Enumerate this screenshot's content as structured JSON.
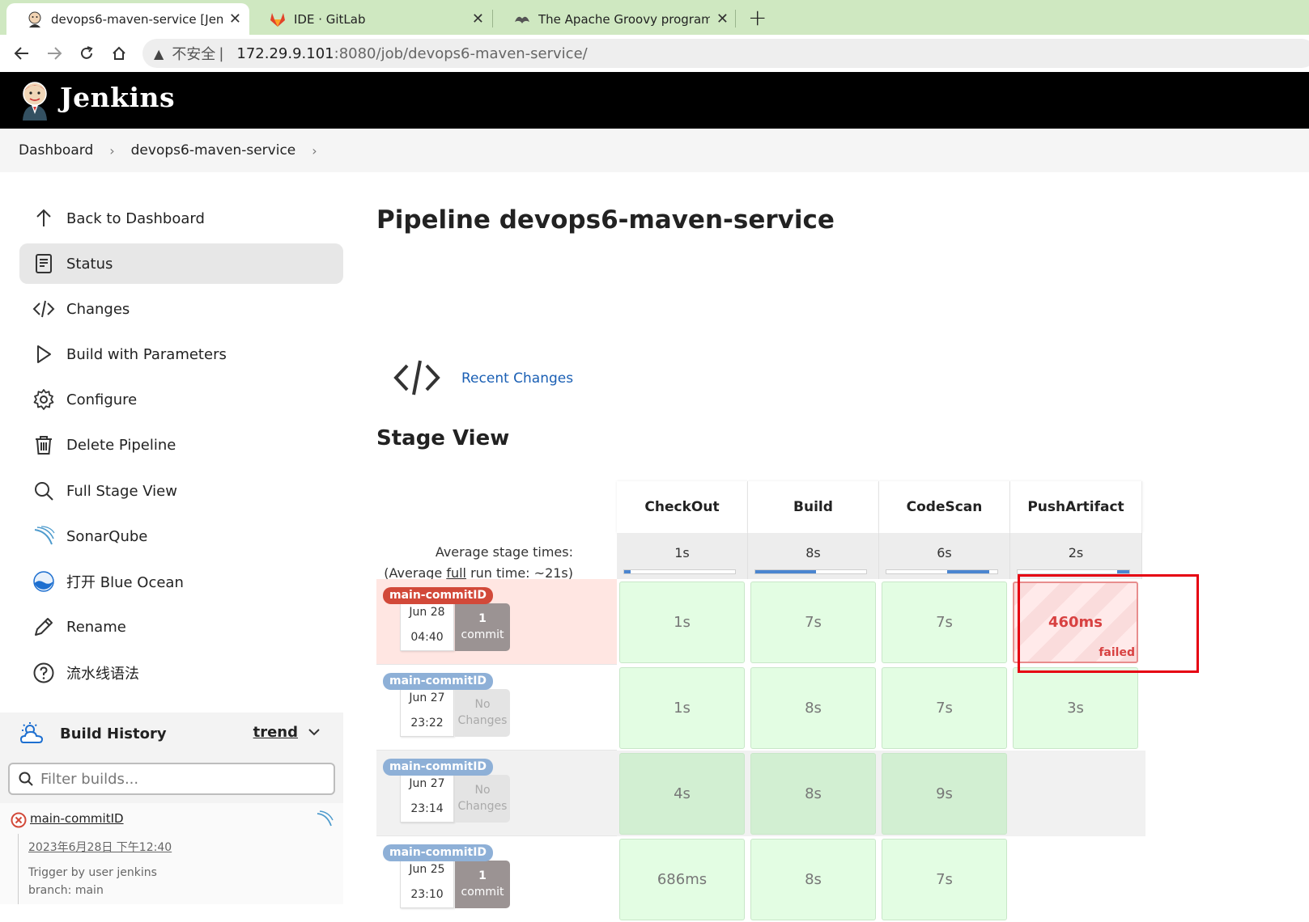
{
  "browser": {
    "tabs": [
      {
        "title": "devops6-maven-service [Jenkins]",
        "active": true
      },
      {
        "title": "IDE · GitLab",
        "active": false
      },
      {
        "title": "The Apache Groovy programming language",
        "active": false
      }
    ],
    "url": {
      "insecure_label": "不安全",
      "separator": "|",
      "host": "172.29.9.101",
      "path": ":8080/job/devops6-maven-service/"
    }
  },
  "header": {
    "brand": "Jenkins"
  },
  "breadcrumbs": [
    "Dashboard",
    "devops6-maven-service"
  ],
  "sidebar": {
    "items": [
      {
        "label": "Back to Dashboard",
        "icon": "arrow-up-icon"
      },
      {
        "label": "Status",
        "icon": "document-icon"
      },
      {
        "label": "Changes",
        "icon": "code-icon"
      },
      {
        "label": "Build with Parameters",
        "icon": "play-icon"
      },
      {
        "label": "Configure",
        "icon": "gear-icon"
      },
      {
        "label": "Delete Pipeline",
        "icon": "trash-icon"
      },
      {
        "label": "Full Stage View",
        "icon": "search-icon"
      },
      {
        "label": "SonarQube",
        "icon": "sonarqube-icon"
      },
      {
        "label": "打开 Blue Ocean",
        "icon": "blue-ocean-icon"
      },
      {
        "label": "Rename",
        "icon": "pencil-icon"
      },
      {
        "label": "流水线语法",
        "icon": "help-icon"
      }
    ]
  },
  "build_history": {
    "title": "Build History",
    "trend_label": "trend",
    "filter_placeholder": "Filter builds...",
    "latest": {
      "name": "main-commitID",
      "date": "2023年6月28日 下午12:40",
      "trigger": "Trigger by user jenkins",
      "branch": "branch: main"
    }
  },
  "main": {
    "title": "Pipeline devops6-maven-service",
    "recent_changes": "Recent Changes",
    "stage_view_title": "Stage View"
  },
  "stage_view": {
    "stages": [
      "CheckOut",
      "Build",
      "CodeScan",
      "PushArtifact"
    ],
    "avg_label": "Average stage times:",
    "avg_run_prefix": "(Average ",
    "avg_run_full": "full",
    "avg_run_suffix": " run time: ~21s)",
    "avg_times": [
      "1s",
      "8s",
      "6s",
      "2s"
    ],
    "avg_bars": [
      {
        "start": 0.0,
        "fill": 0.06
      },
      {
        "start": 0.0,
        "fill": 0.55
      },
      {
        "start": 0.55,
        "fill": 0.38
      },
      {
        "start": 0.89,
        "fill": 0.11
      }
    ],
    "runs": [
      {
        "badge": "main-commitID",
        "status": "failed",
        "date": "Jun 28",
        "time": "04:40",
        "changes_count": "1",
        "changes_label": "commit",
        "has_commit": true,
        "cells": [
          {
            "time": "1s",
            "state": "ok"
          },
          {
            "time": "7s",
            "state": "ok"
          },
          {
            "time": "7s",
            "state": "ok"
          },
          {
            "time": "460ms",
            "state": "fail",
            "label": "failed"
          }
        ]
      },
      {
        "badge": "main-commitID",
        "status": "success",
        "date": "Jun 27",
        "time": "23:22",
        "changes_count": "No",
        "changes_label": "Changes",
        "has_commit": false,
        "cells": [
          {
            "time": "1s",
            "state": "ok"
          },
          {
            "time": "8s",
            "state": "ok"
          },
          {
            "time": "7s",
            "state": "ok"
          },
          {
            "time": "3s",
            "state": "ok"
          }
        ]
      },
      {
        "badge": "main-commitID",
        "status": "success",
        "date": "Jun 27",
        "time": "23:14",
        "changes_count": "No",
        "changes_label": "Changes",
        "has_commit": false,
        "cells": [
          {
            "time": "4s",
            "state": "ok"
          },
          {
            "time": "8s",
            "state": "ok"
          },
          {
            "time": "9s",
            "state": "ok"
          },
          {
            "time": "",
            "state": "empty"
          }
        ]
      },
      {
        "badge": "main-commitID",
        "status": "success",
        "date": "Jun 25",
        "time": "23:10",
        "changes_count": "1",
        "changes_label": "commit",
        "has_commit": true,
        "cells": [
          {
            "time": "686ms",
            "state": "ok"
          },
          {
            "time": "8s",
            "state": "ok"
          },
          {
            "time": "7s",
            "state": "ok"
          },
          {
            "time": "",
            "state": "empty"
          }
        ]
      }
    ]
  },
  "colors": {
    "tabbar": "#cfe8c1",
    "header": "#000000",
    "badge_failed": "#d24939",
    "badge_success": "#8eb0d7",
    "row_failed_bg": "#ffe6e2",
    "cell_success": "#e3fde3",
    "cell_failed_text": "#d84141",
    "link": "#1a5fb4",
    "annotation_box": "#e60012"
  }
}
